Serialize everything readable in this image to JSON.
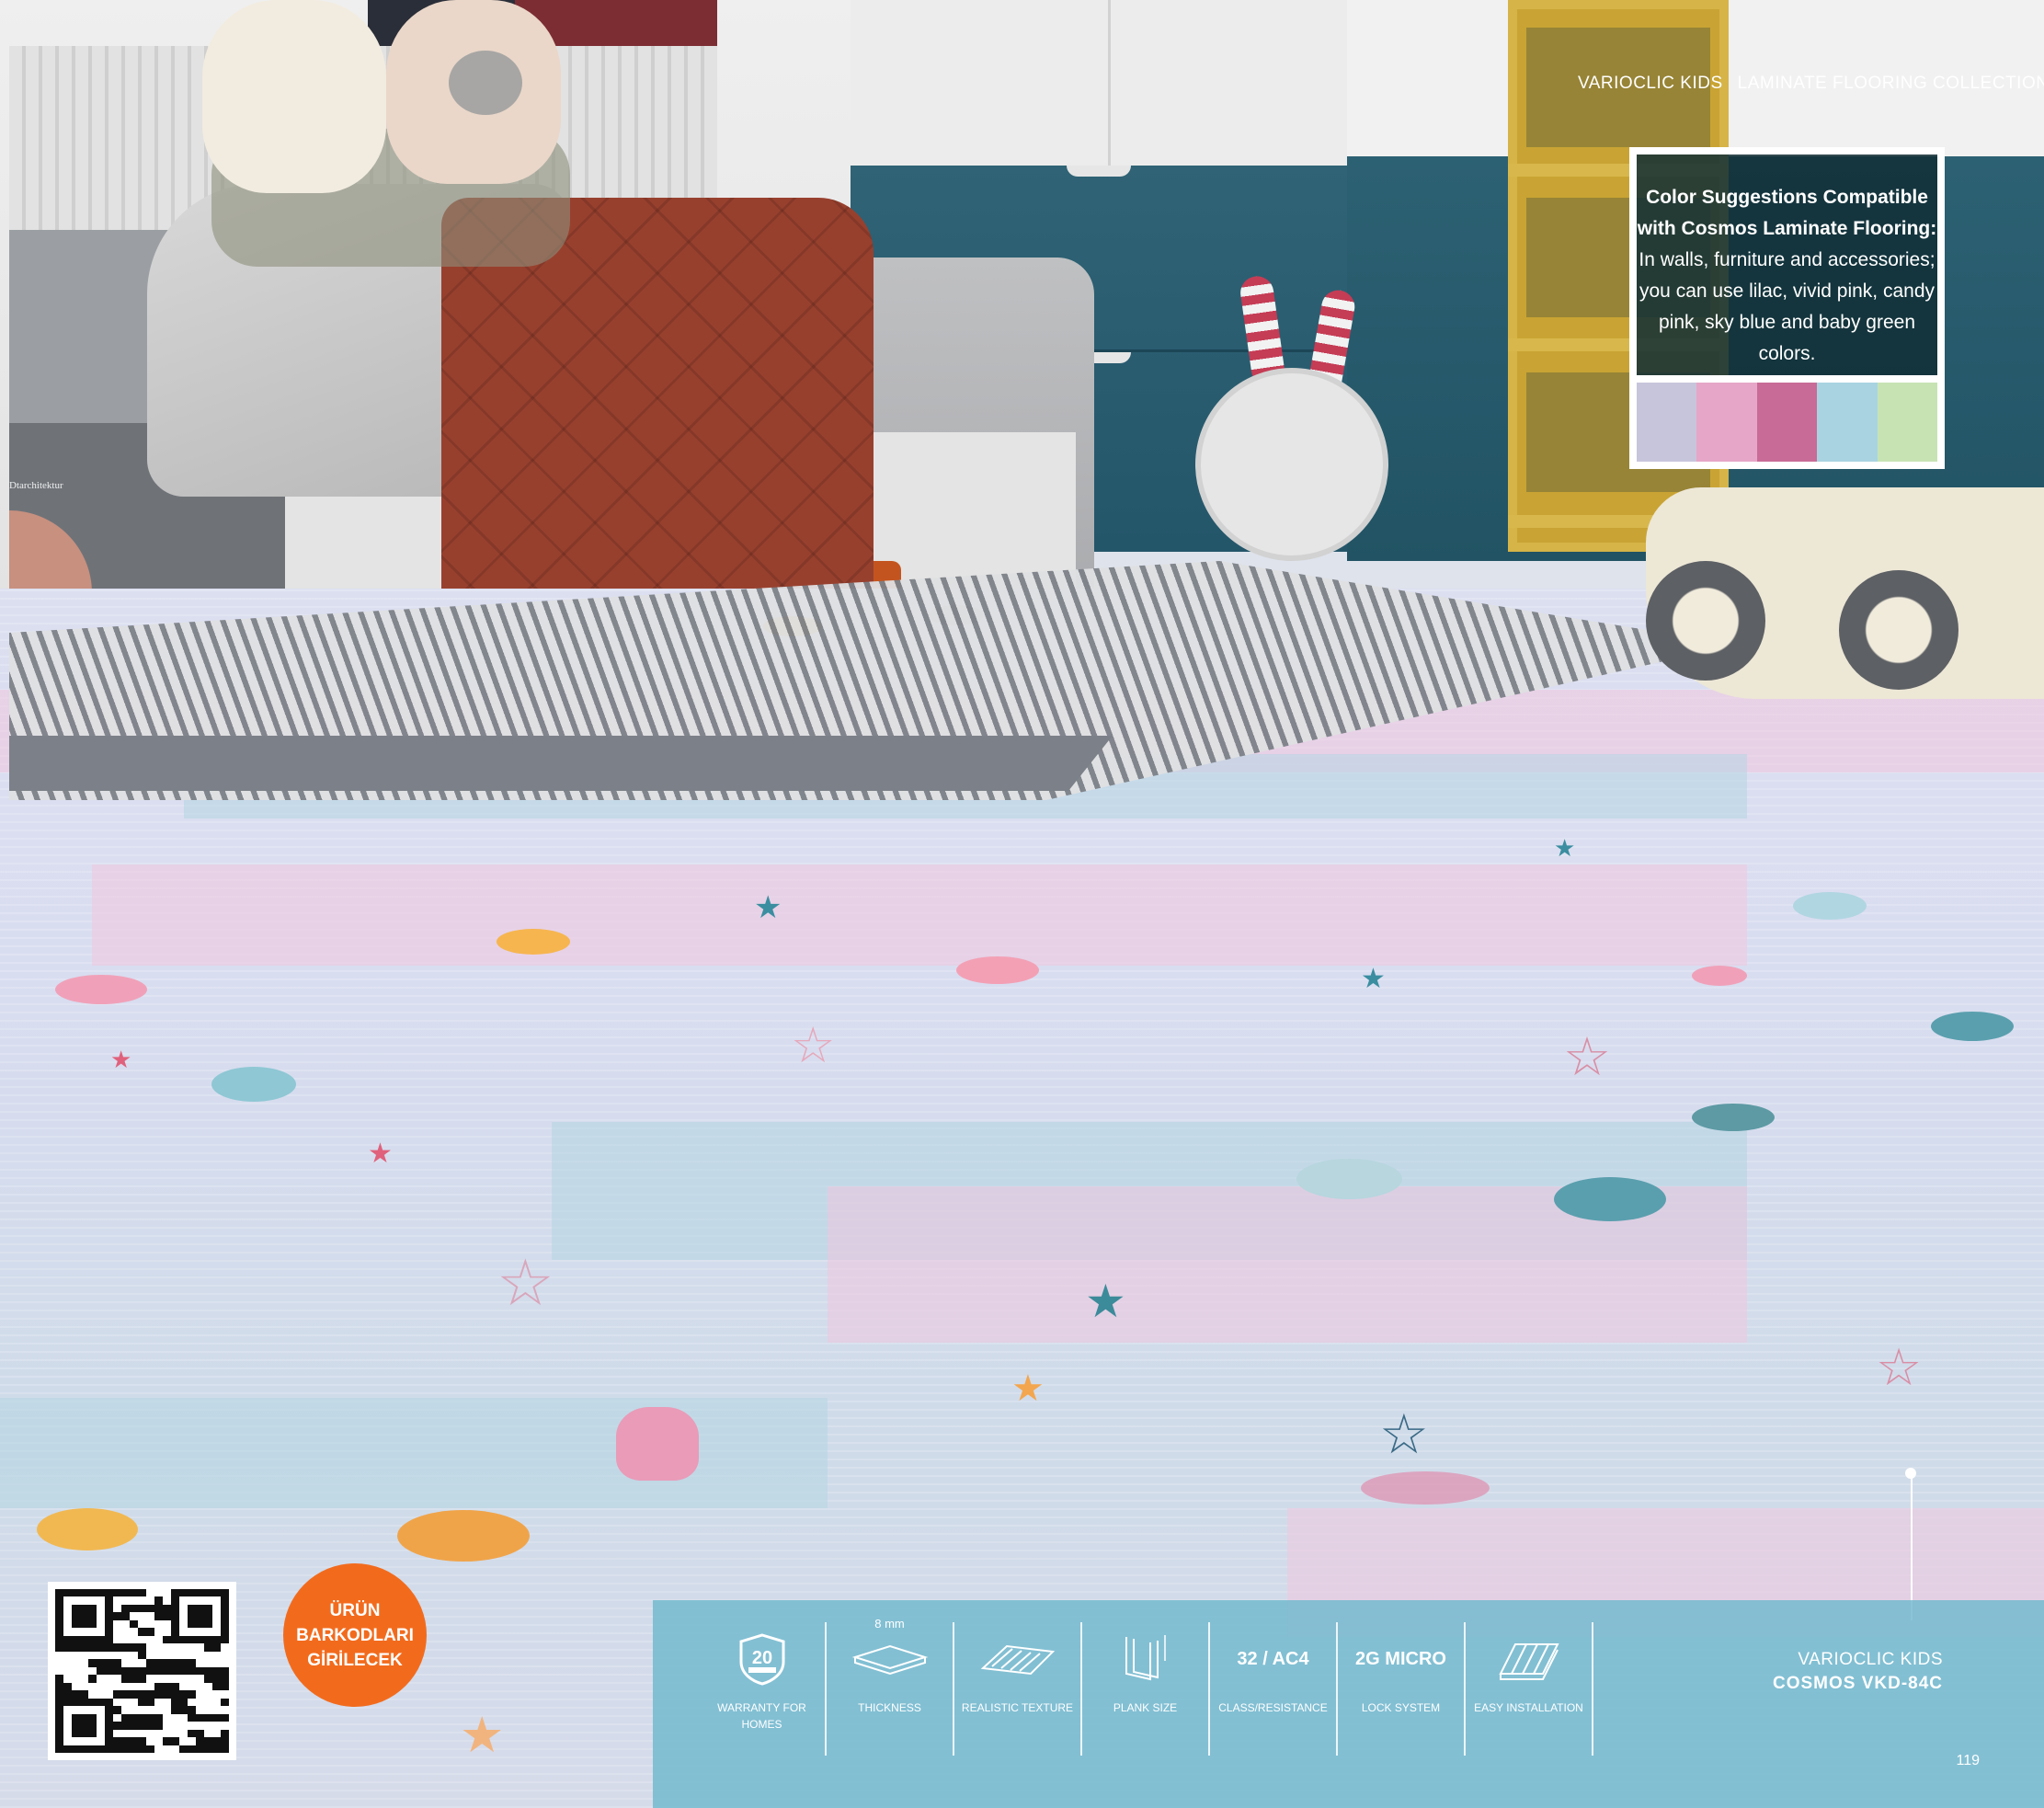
{
  "header": {
    "brand": "VARIOCLIC KIDS",
    "collection": "LAMINATE FLOORING COLLECTION"
  },
  "color_suggestions": {
    "title_line1": "Color Suggestions Compatible",
    "title_line2": "with Cosmos Laminate Flooring:",
    "body_line1": "In walls, furniture and accessories;",
    "body_line2": "you can use lilac, vivid pink, candy",
    "body_line3": "pink, sky blue and baby green",
    "body_line4": "colors.",
    "swatches": [
      "#c7c5dc",
      "#e6a6c7",
      "#c86b96",
      "#a9d3e1",
      "#c7e3b3"
    ]
  },
  "badge": {
    "line1": "ÜRÜN",
    "line2": "BARKODLARI",
    "line3": "GİRİLECEK"
  },
  "watermark": "Dtarchitektur",
  "specs": [
    {
      "icon": "warranty-20-years-icon",
      "icon_text": "20",
      "label": "WARRANTY FOR HOMES",
      "top": ""
    },
    {
      "icon": "thickness-icon",
      "icon_text": "",
      "label": "THICKNESS",
      "top": "8 mm"
    },
    {
      "icon": "realistic-texture-icon",
      "icon_text": "",
      "label": "REALISTIC TEXTURE",
      "top": ""
    },
    {
      "icon": "plank-size-icon",
      "icon_text": "",
      "label": "PLANK SIZE",
      "top": ""
    },
    {
      "icon": "class-resistance-icon",
      "icon_text": "32 / AC4",
      "label": "CLASS/RESISTANCE",
      "top": ""
    },
    {
      "icon": "lock-system-icon",
      "icon_text": "2G MICRO",
      "label": "LOCK SYSTEM",
      "top": ""
    },
    {
      "icon": "easy-installation-icon",
      "icon_text": "",
      "label": "EASY INSTALLATION",
      "top": ""
    }
  ],
  "product": {
    "series": "VARIOCLIC KIDS",
    "name": "COSMOS  VKD-84C"
  },
  "page_number": "119",
  "colors": {
    "orange_badge": "#f26b1d",
    "spec_bar": "#70b8ce",
    "teal_wall": "#2c6173"
  }
}
